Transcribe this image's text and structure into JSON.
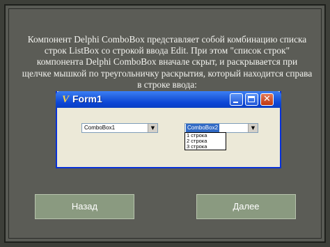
{
  "caption": "Компонент Delphi ComboBox представляет собой комбинацию списка строк ListBox со строкой ввода Edit. При этом \"список строк\" компонента Delphi ComboBox вначале скрыт, и раскрывается при щелчке мышкой по треугольничку раскрытия, который находится справа в строке ввода:",
  "form": {
    "title": "Form1",
    "icon": "delphi-icon",
    "controls": {
      "minimize": "minimize-icon",
      "maximize": "maximize-icon",
      "close": "✕"
    },
    "combobox1": {
      "value": "ComboBox1"
    },
    "combobox2": {
      "value": "ComboBox2",
      "items": [
        "1 строка",
        "2 строка",
        "3 строка"
      ]
    }
  },
  "navigation": {
    "back_label": "Назад",
    "next_label": "Далее"
  },
  "colors": {
    "background": "#595b55",
    "title_bar": "#0c46d6",
    "button": "#8a9a80"
  }
}
